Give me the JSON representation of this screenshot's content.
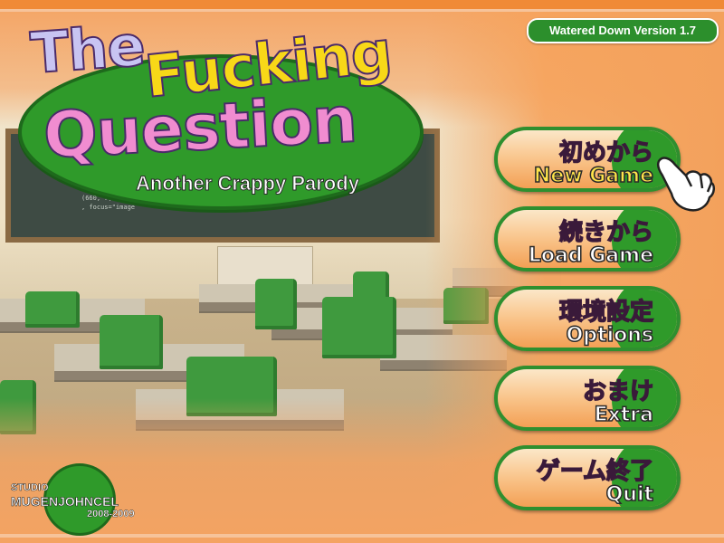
{
  "version_badge": "Watered Down Version 1.7",
  "logo": {
    "line1": "The",
    "line2": "Fucking",
    "line3": "Question",
    "subtitle": "Another Crappy Parody"
  },
  "blackboard_text": "(560, 1\n(660, 7, 165,\n, focus=\"image",
  "menu": [
    {
      "jp": "初めから",
      "en": "New Game",
      "selected": true
    },
    {
      "jp": "続きから",
      "en": "Load Game",
      "selected": false
    },
    {
      "jp": "環境設定",
      "en": "Options",
      "selected": false
    },
    {
      "jp": "おまけ",
      "en": "Extra",
      "selected": false
    },
    {
      "jp": "ゲーム終了",
      "en": "Quit",
      "selected": false
    }
  ],
  "studio": {
    "label": "STUDIO",
    "name": "MUGENJOHNCEL",
    "years": "2008-2009"
  },
  "colors": {
    "frame_orange": "#f4a362",
    "button_green": "#2f9a2a",
    "title_yellow": "#f8d818",
    "title_pink": "#f08cd0",
    "title_lavender": "#c8c4f2"
  },
  "icons": {
    "cursor": "pointing-hand-icon"
  }
}
